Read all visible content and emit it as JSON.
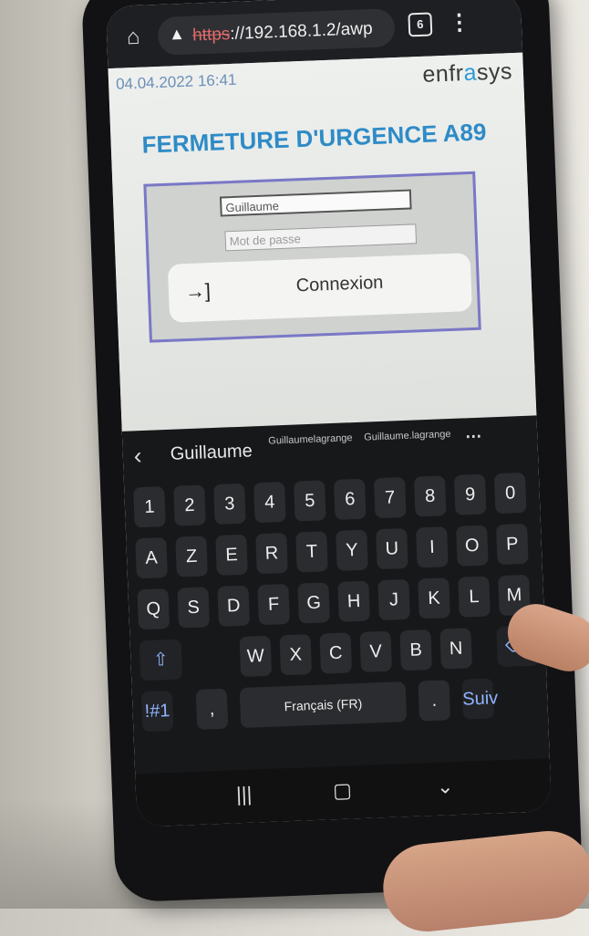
{
  "browser": {
    "url_scheme": "https",
    "url_rest": "://192.168.1.2/awp",
    "tab_count": "6"
  },
  "page": {
    "datetime": "04.04.2022 16:41",
    "logo_pre": "enfr",
    "logo_accent": "a",
    "logo_post": "sys",
    "title": "FERMETURE D'URGENCE A89",
    "username_value": "Guillaume",
    "password_placeholder": "Mot de passe",
    "login_button": "Connexion"
  },
  "keyboard": {
    "suggestions": [
      "Guillaume",
      "Guillaumelagrange",
      "Guillaume.lagrange"
    ],
    "numbers": [
      "1",
      "2",
      "3",
      "4",
      "5",
      "6",
      "7",
      "8",
      "9",
      "0"
    ],
    "row1": [
      "A",
      "Z",
      "E",
      "R",
      "T",
      "Y",
      "U",
      "I",
      "O",
      "P"
    ],
    "row2": [
      "Q",
      "S",
      "D",
      "F",
      "G",
      "H",
      "J",
      "K",
      "L",
      "M"
    ],
    "row3": [
      "W",
      "X",
      "C",
      "V",
      "B",
      "N"
    ],
    "symbols_key": "!#1",
    "comma_key": ",",
    "space_label": "Français (FR)",
    "period_key": ".",
    "enter_label": "Suiv",
    "accent_color": "#8fb3ff"
  },
  "colors": {
    "title": "#2e8bc7",
    "panel_border": "#7a78c6",
    "datetime": "#6c8fb8"
  }
}
